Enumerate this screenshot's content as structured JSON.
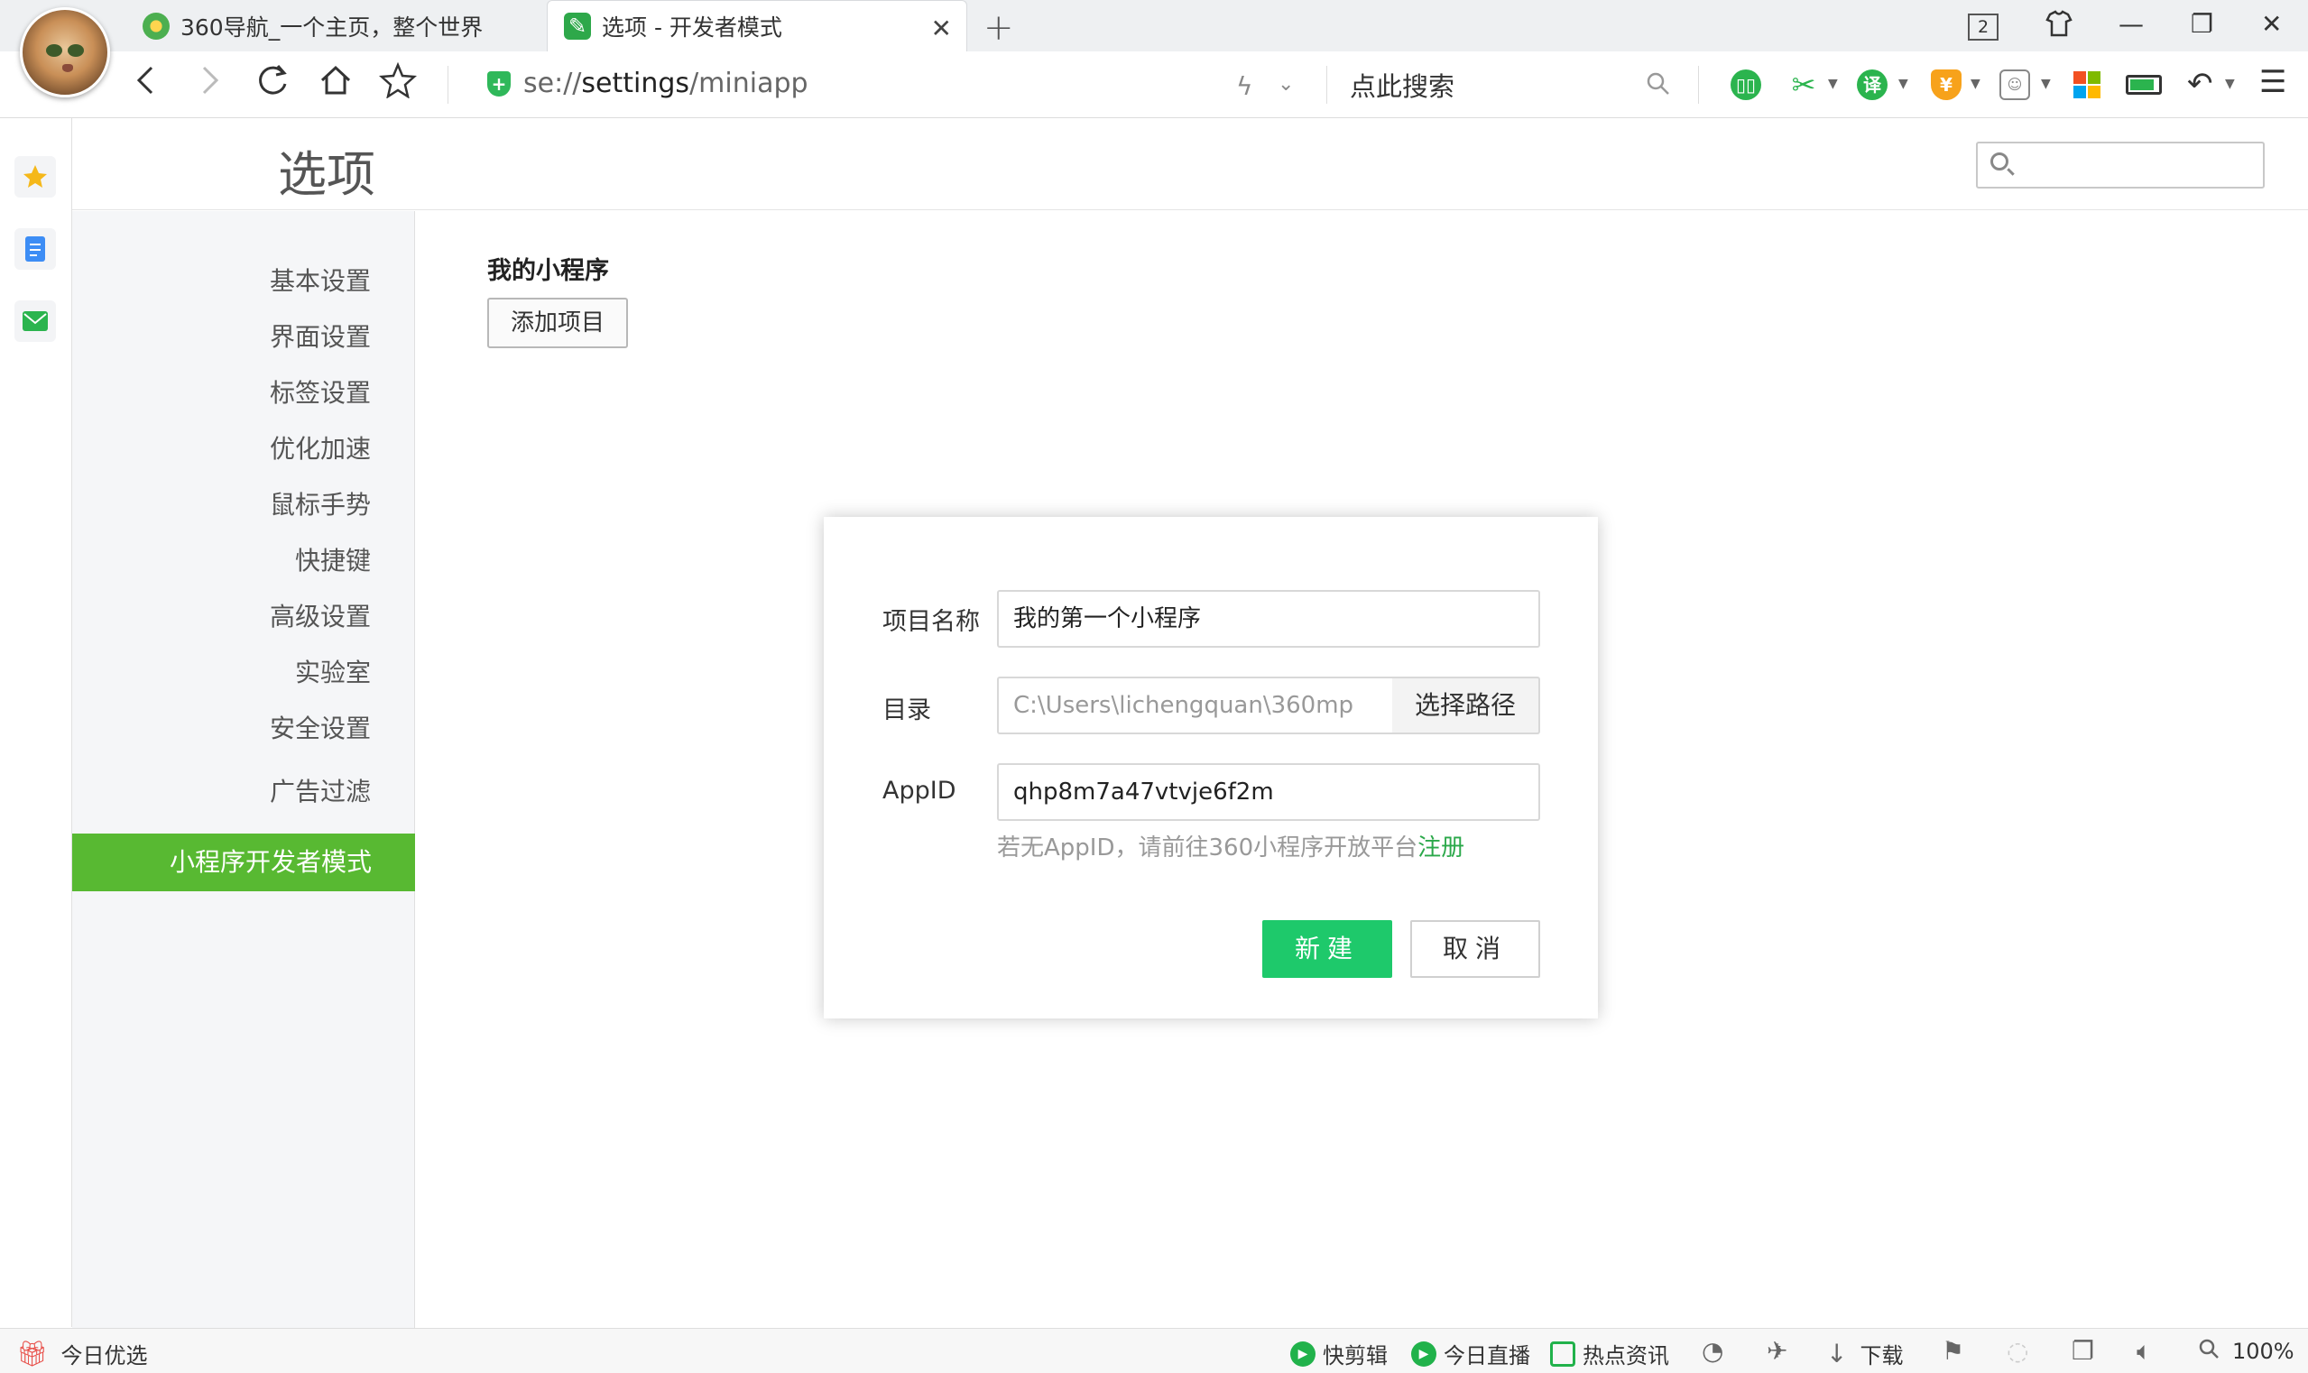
{
  "browser": {
    "tabs": [
      {
        "label": "360导航_一个主页，整个世界",
        "active": false
      },
      {
        "label": "选项 - 开发者模式",
        "active": true
      }
    ],
    "tab_count": "2",
    "address": {
      "prefix": "se://",
      "host": "settings",
      "path": "/miniapp"
    },
    "search_placeholder": "点此搜索",
    "toolbar_icons": [
      "reading-mode-icon",
      "scissors-icon",
      "translate-icon",
      "shield-coin-icon",
      "game-icon",
      "app-grid-icon",
      "battery-icon",
      "undo-icon",
      "menu-icon"
    ]
  },
  "settings": {
    "page_title": "选项",
    "search": {
      "placeholder": ""
    },
    "nav": [
      {
        "label": "基本设置"
      },
      {
        "label": "界面设置"
      },
      {
        "label": "标签设置"
      },
      {
        "label": "优化加速"
      },
      {
        "label": "鼠标手势"
      },
      {
        "label": "快捷键"
      },
      {
        "label": "高级设置"
      },
      {
        "label": "实验室"
      },
      {
        "label": "安全设置"
      },
      {
        "label": "广告过滤"
      }
    ],
    "nav_active": "小程序开发者模式",
    "section_title": "我的小程序",
    "add_button": "添加项目"
  },
  "dialog": {
    "name_label": "项目名称",
    "name_value": "我的第一个小程序",
    "dir_label": "目录",
    "dir_value": "C:\\Users\\lichengquan\\360mp",
    "choose_path": "选择路径",
    "appid_label": "AppID",
    "appid_value": "qhp8m7a47vtvje6f2m",
    "hint_text": "若无AppID，请前往360小程序开放平台",
    "hint_link": "注册",
    "confirm": "新建",
    "cancel": "取消"
  },
  "statusbar": {
    "left": "今日优选",
    "items": [
      "快剪辑",
      "今日直播",
      "热点资讯"
    ],
    "download": "下载",
    "zoom": "100%"
  },
  "colors": {
    "accent_green": "#58b932",
    "primary_button": "#1ec96b",
    "link": "#2ba84a"
  }
}
